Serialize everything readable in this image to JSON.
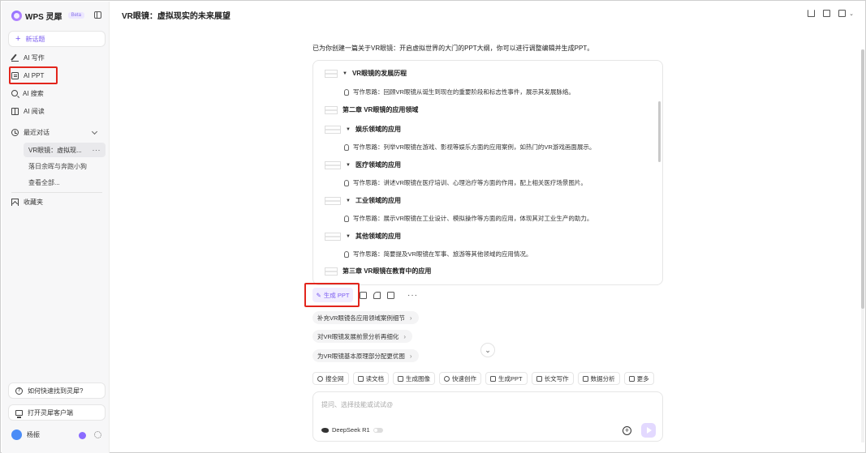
{
  "app": {
    "name": "WPS 灵犀",
    "badge": "Beta"
  },
  "sidebar": {
    "new_topic": "新话题",
    "items": [
      {
        "label": "AI 写作",
        "icon": "pen-icon"
      },
      {
        "label": "AI PPT",
        "icon": "ppt-icon"
      },
      {
        "label": "AI 搜索",
        "icon": "search-icon"
      },
      {
        "label": "AI 阅读",
        "icon": "book-icon"
      }
    ],
    "recent_label": "最近对话",
    "recent_items": [
      "VR眼镜：虚拟现...",
      "落日余晖与奔跑小狗",
      "查看全部..."
    ],
    "favorites": "收藏夹",
    "help": "如何快速找到灵犀?",
    "open_client": "打开灵犀客户端",
    "user_name": "杨振"
  },
  "header": {
    "title": "VR眼镜：虚拟现实的未来展望"
  },
  "main": {
    "intro": "已为你创建一篇关于VR眼镜：开启虚拟世界的大门的PPT大纲，你可以进行调整编辑并生成PPT。",
    "outline": [
      {
        "kind": "section",
        "text": "VR眼镜的发展历程"
      },
      {
        "kind": "note",
        "text": "写作思路：回顾VR眼镜从诞生到现在的重要阶段和标志性事件，展示其发展脉络。"
      },
      {
        "kind": "chapter",
        "text": "第二章 VR眼镜的应用领域"
      },
      {
        "kind": "section",
        "text": "娱乐领域的应用"
      },
      {
        "kind": "note",
        "text": "写作思路：列举VR眼镜在游戏、影视等娱乐方面的应用案例，如热门的VR游戏画面展示。"
      },
      {
        "kind": "section",
        "text": "医疗领域的应用"
      },
      {
        "kind": "note",
        "text": "写作思路：讲述VR眼镜在医疗培训、心理治疗等方面的作用，配上相关医疗场景图片。"
      },
      {
        "kind": "section",
        "text": "工业领域的应用"
      },
      {
        "kind": "note",
        "text": "写作思路：展示VR眼镜在工业设计、模拟操作等方面的应用，体现其对工业生产的助力。"
      },
      {
        "kind": "section",
        "text": "其他领域的应用"
      },
      {
        "kind": "note",
        "text": "写作思路：简要提及VR眼镜在军事、旅游等其他领域的应用情况。"
      },
      {
        "kind": "chapter",
        "text": "第三章 VR眼镜在教育中的应用"
      }
    ],
    "generate_ppt": "生成 PPT",
    "suggestions": [
      "补充VR眼镜各应用领域案例细节",
      "对VR眼镜发展前景分析再细化",
      "为VR眼镜基本原理部分配更优图"
    ],
    "skills": [
      "搜全网",
      "读文档",
      "生成图像",
      "快速创作",
      "生成PPT",
      "长文写作",
      "数据分析",
      "更多"
    ],
    "input_placeholder": "提问、选择技能或试试@",
    "model": "DeepSeek R1"
  }
}
